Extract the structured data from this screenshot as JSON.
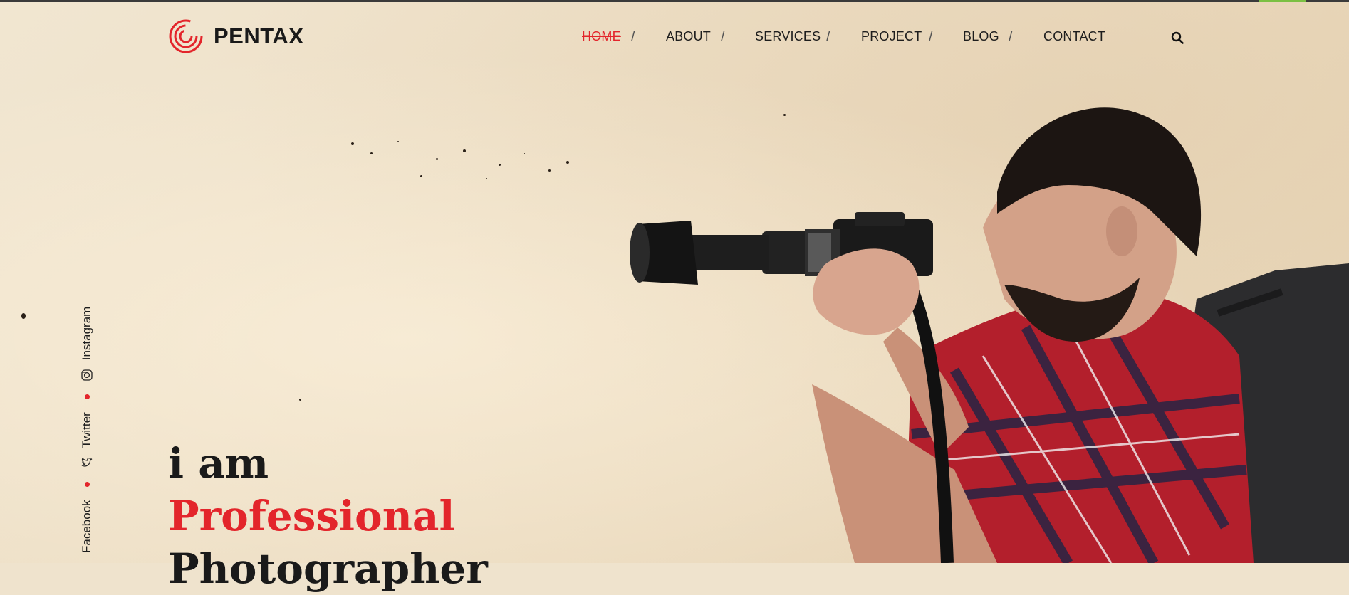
{
  "brand": {
    "name": "PENTAX",
    "icon": "spiral-logo-icon",
    "accent": "#e3252b"
  },
  "nav": {
    "items": [
      {
        "label": "HOME",
        "active": true
      },
      {
        "label": "ABOUT",
        "active": false
      },
      {
        "label": "SERVICES",
        "active": false
      },
      {
        "label": "PROJECT",
        "active": false
      },
      {
        "label": "BLOG",
        "active": false
      },
      {
        "label": "CONTACT",
        "active": false
      }
    ],
    "separator": "/",
    "search_icon": "search-icon"
  },
  "social": {
    "items": [
      {
        "label": "Facebook",
        "icon": "facebook-icon"
      },
      {
        "label": "Twitter",
        "icon": "twitter-icon"
      },
      {
        "label": "Instagram",
        "icon": "instagram-icon"
      }
    ]
  },
  "hero": {
    "line1": "i am",
    "line2": "Professional",
    "line3": "Photographer"
  }
}
